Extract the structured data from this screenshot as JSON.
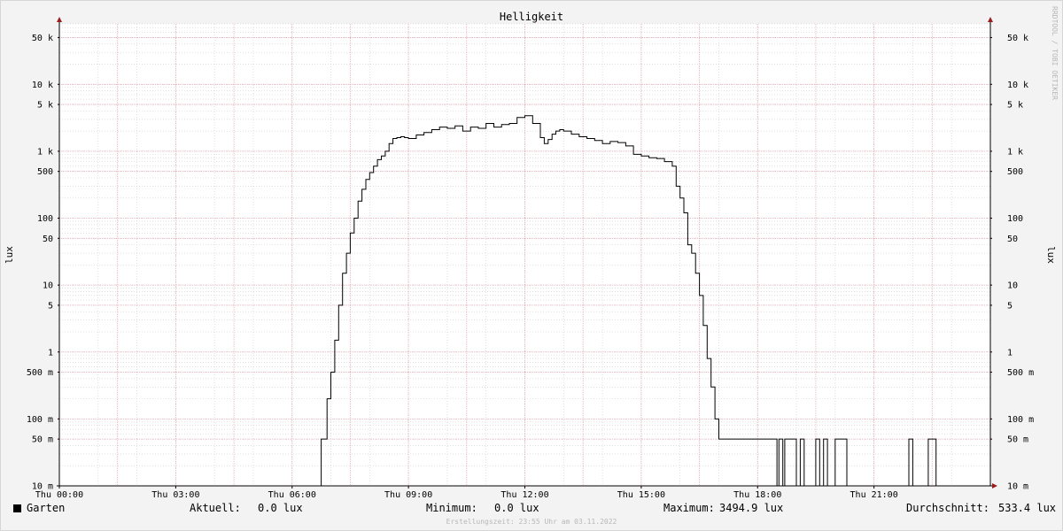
{
  "chart_data": {
    "type": "line",
    "title": "Helligkeit",
    "ylabel": "lux",
    "yscale": "log",
    "ylim": [
      0.01,
      80000
    ],
    "y_ticks": [
      {
        "value": 0.01,
        "label": "10 m"
      },
      {
        "value": 0.05,
        "label": "50 m"
      },
      {
        "value": 0.1,
        "label": "100 m"
      },
      {
        "value": 0.5,
        "label": "500 m"
      },
      {
        "value": 1,
        "label": "1"
      },
      {
        "value": 5,
        "label": "5"
      },
      {
        "value": 10,
        "label": "10"
      },
      {
        "value": 50,
        "label": "50"
      },
      {
        "value": 100,
        "label": "100"
      },
      {
        "value": 500,
        "label": "500"
      },
      {
        "value": 1000,
        "label": "1 k"
      },
      {
        "value": 5000,
        "label": "5 k"
      },
      {
        "value": 10000,
        "label": "10 k"
      },
      {
        "value": 50000,
        "label": "50 k"
      }
    ],
    "xlim": [
      "2022-11-03 00:00",
      "2022-11-04 00:00"
    ],
    "x_ticks": [
      {
        "hour": 0,
        "label": "Thu 00:00"
      },
      {
        "hour": 3,
        "label": "Thu 03:00"
      },
      {
        "hour": 6,
        "label": "Thu 06:00"
      },
      {
        "hour": 9,
        "label": "Thu 09:00"
      },
      {
        "hour": 12,
        "label": "Thu 12:00"
      },
      {
        "hour": 15,
        "label": "Thu 15:00"
      },
      {
        "hour": 18,
        "label": "Thu 18:00"
      },
      {
        "hour": 21,
        "label": "Thu 21:00"
      }
    ],
    "grid": true,
    "series": [
      {
        "name": "Garten",
        "color": "#000000",
        "x": [
          0,
          6.75,
          6.9,
          7.0,
          7.1,
          7.2,
          7.3,
          7.4,
          7.5,
          7.6,
          7.7,
          7.8,
          7.9,
          8.0,
          8.1,
          8.2,
          8.3,
          8.4,
          8.5,
          8.6,
          8.7,
          8.8,
          8.9,
          9.0,
          9.2,
          9.4,
          9.6,
          9.8,
          10.0,
          10.2,
          10.4,
          10.6,
          10.8,
          11.0,
          11.2,
          11.4,
          11.6,
          11.8,
          12.0,
          12.2,
          12.4,
          12.5,
          12.6,
          12.7,
          12.8,
          12.9,
          13.0,
          13.2,
          13.4,
          13.6,
          13.8,
          14.0,
          14.2,
          14.4,
          14.6,
          14.8,
          15.0,
          15.2,
          15.4,
          15.6,
          15.8,
          15.9,
          16.0,
          16.1,
          16.2,
          16.3,
          16.4,
          16.5,
          16.6,
          16.7,
          16.8,
          16.9,
          17.0,
          17.1,
          17.2,
          17.3,
          17.4,
          17.5,
          17.6,
          17.7,
          17.8,
          18.0,
          18.5,
          18.55,
          18.65,
          18.7,
          19.0,
          19.1,
          19.2,
          19.5,
          19.6,
          19.7,
          19.8,
          20.0,
          20.3,
          20.5,
          20.6,
          21.0,
          21.8,
          21.9,
          22.0,
          22.4,
          22.6,
          24.0
        ],
        "y": [
          0.01,
          0.05,
          0.2,
          0.5,
          1.5,
          5,
          15,
          30,
          60,
          100,
          180,
          270,
          380,
          480,
          600,
          750,
          850,
          1000,
          1300,
          1550,
          1600,
          1650,
          1600,
          1550,
          1750,
          1900,
          2100,
          2300,
          2200,
          2400,
          2000,
          2300,
          2200,
          2600,
          2300,
          2500,
          2600,
          3200,
          3400,
          2600,
          1600,
          1300,
          1500,
          1800,
          2000,
          2100,
          2000,
          1800,
          1650,
          1550,
          1450,
          1300,
          1400,
          1350,
          1200,
          900,
          850,
          800,
          780,
          700,
          600,
          300,
          200,
          120,
          40,
          30,
          15,
          7,
          2.5,
          0.8,
          0.3,
          0.1,
          0.05,
          0.05,
          0.05,
          0.05,
          0.05,
          0.05,
          0.05,
          0.05,
          0.05,
          0.05,
          0.01,
          0.05,
          0.01,
          0.05,
          0.01,
          0.05,
          0.01,
          0.05,
          0.01,
          0.05,
          0.01,
          0.05,
          0.01,
          0.01,
          0.01,
          0.01,
          0.01,
          0.05,
          0.01,
          0.05,
          0.01,
          0.01
        ]
      }
    ]
  },
  "watermark": "RRDTOOL / TOBI OETIKER",
  "legend": {
    "name": "Garten",
    "aktuell_label": "Aktuell:",
    "aktuell_value": "0.0 lux",
    "minimum_label": "Minimum:",
    "minimum_value": "0.0 lux",
    "maximum_label": "Maximum:",
    "maximum_value": "3494.9 lux",
    "avg_label": "Durchschnitt:",
    "avg_value": "533.4 lux"
  },
  "footer": "Erstellungszeit: 23:55 Uhr am 03.11.2022",
  "colors": {
    "major_grid": "#e8a8b4",
    "minor_grid": "#cccccc",
    "axis": "#000000",
    "arrow": "#9b1c1c"
  }
}
